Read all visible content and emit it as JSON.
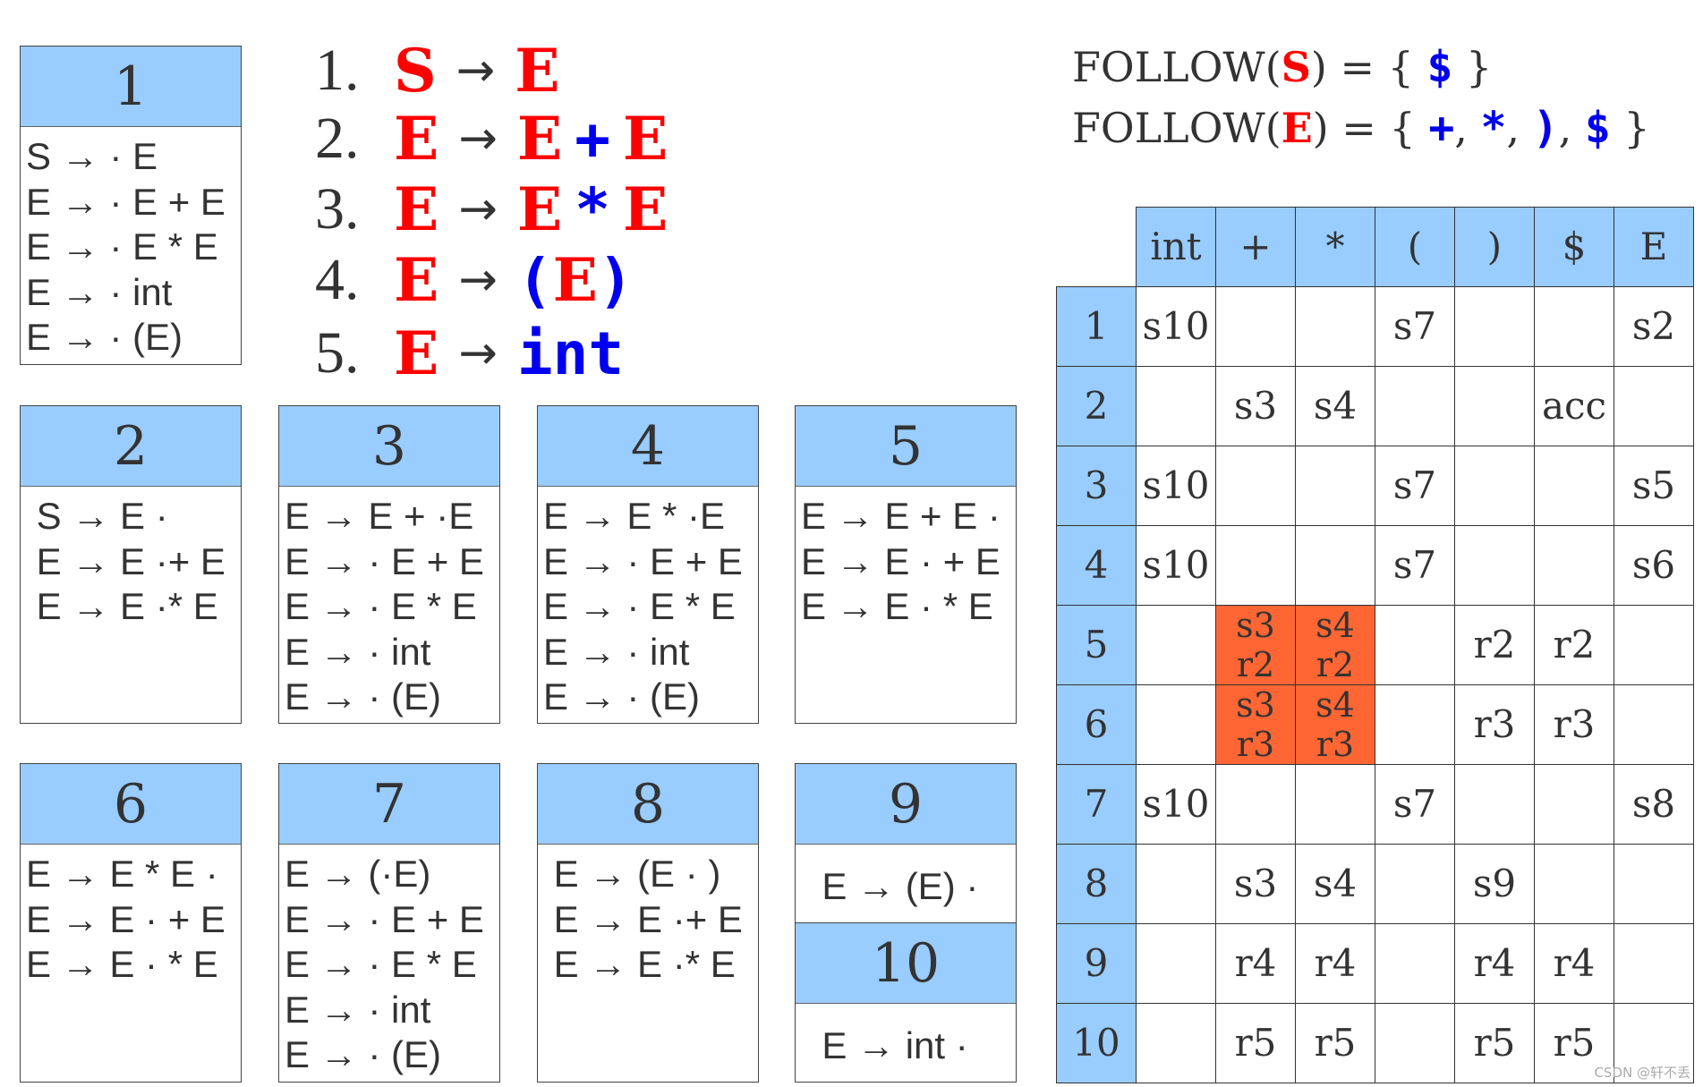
{
  "colors": {
    "header": "#99ccff",
    "nonterminal": "#ff0000",
    "terminal": "#0000ee",
    "conflict": "#ff6633"
  },
  "grammar": [
    {
      "num": "1.",
      "lhs": "S",
      "rhs": [
        {
          "t": "E",
          "k": "nt"
        }
      ]
    },
    {
      "num": "2.",
      "lhs": "E",
      "rhs": [
        {
          "t": "E",
          "k": "nt"
        },
        {
          "t": "+",
          "k": "tm"
        },
        {
          "t": "E",
          "k": "nt"
        }
      ]
    },
    {
      "num": "3.",
      "lhs": "E",
      "rhs": [
        {
          "t": "E",
          "k": "nt"
        },
        {
          "t": "*",
          "k": "tm"
        },
        {
          "t": "E",
          "k": "nt"
        }
      ]
    },
    {
      "num": "4.",
      "lhs": "E",
      "rhs": [
        {
          "t": "(",
          "k": "tm"
        },
        {
          "t": "E",
          "k": "nt"
        },
        {
          "t": ")",
          "k": "tm"
        }
      ]
    },
    {
      "num": "5.",
      "lhs": "E",
      "rhs": [
        {
          "t": "int",
          "k": "tm"
        }
      ]
    }
  ],
  "arrow": "→",
  "follow": [
    {
      "prefix": "FOLLOW(",
      "sym": "S",
      "mid": ") = { ",
      "set": [
        "$"
      ],
      "suffix": " }"
    },
    {
      "prefix": "FOLLOW(",
      "sym": "E",
      "mid": ") = { ",
      "set": [
        "+",
        "*",
        ")",
        "$"
      ],
      "suffix": " }"
    }
  ],
  "states": [
    {
      "id": "1",
      "items": [
        "S → · E",
        "E → · E + E",
        "E → · E * E",
        "E → · int",
        "E → · (E)"
      ]
    },
    {
      "id": "2",
      "items": [
        " S → E ·",
        " E → E ·+ E",
        " E → E ·* E"
      ]
    },
    {
      "id": "3",
      "items": [
        "E → E + ·E",
        "E → · E + E",
        "E → · E * E",
        "E → · int",
        "E → · (E)"
      ]
    },
    {
      "id": "4",
      "items": [
        "E → E * ·E",
        "E → · E + E",
        "E → · E * E",
        "E → · int",
        "E → · (E)"
      ]
    },
    {
      "id": "5",
      "items": [
        "E → E + E ·",
        "E → E · + E",
        "E → E · * E"
      ]
    },
    {
      "id": "6",
      "items": [
        "E → E * E ·",
        "E → E · + E",
        "E → E · * E"
      ]
    },
    {
      "id": "7",
      "items": [
        "E → (·E)",
        "E → · E + E",
        "E → · E * E",
        "E → · int",
        "E → · (E)"
      ]
    },
    {
      "id": "8",
      "items": [
        " E → (E · )",
        " E → E ·+ E",
        " E → E ·* E"
      ]
    },
    {
      "id": "9",
      "items": [
        "  E → (E) ·"
      ]
    },
    {
      "id": "10",
      "items": [
        "  E → int ·"
      ]
    }
  ],
  "table": {
    "columns": [
      "int",
      "+",
      "*",
      "(",
      ")",
      "$",
      "E"
    ],
    "rows": [
      {
        "state": "1",
        "cells": [
          "s10",
          "",
          "",
          "s7",
          "",
          "",
          "s2"
        ]
      },
      {
        "state": "2",
        "cells": [
          "",
          "s3",
          "s4",
          "",
          "",
          "acc",
          ""
        ]
      },
      {
        "state": "3",
        "cells": [
          "s10",
          "",
          "",
          "s7",
          "",
          "",
          "s5"
        ]
      },
      {
        "state": "4",
        "cells": [
          "s10",
          "",
          "",
          "s7",
          "",
          "",
          "s6"
        ]
      },
      {
        "state": "5",
        "cells": [
          "",
          "s3\nr2",
          "s4\nr2",
          "",
          "r2",
          "r2",
          ""
        ],
        "conflicts": [
          1,
          2
        ]
      },
      {
        "state": "6",
        "cells": [
          "",
          "s3\nr3",
          "s4\nr3",
          "",
          "r3",
          "r3",
          ""
        ],
        "conflicts": [
          1,
          2
        ]
      },
      {
        "state": "7",
        "cells": [
          "s10",
          "",
          "",
          "s7",
          "",
          "",
          "s8"
        ]
      },
      {
        "state": "8",
        "cells": [
          "",
          "s3",
          "s4",
          "",
          "s9",
          "",
          ""
        ]
      },
      {
        "state": "9",
        "cells": [
          "",
          "r4",
          "r4",
          "",
          "r4",
          "r4",
          ""
        ]
      },
      {
        "state": "10",
        "cells": [
          "",
          "r5",
          "r5",
          "",
          "r5",
          "r5",
          ""
        ]
      }
    ]
  },
  "watermark": "CSDN @轩不丢"
}
